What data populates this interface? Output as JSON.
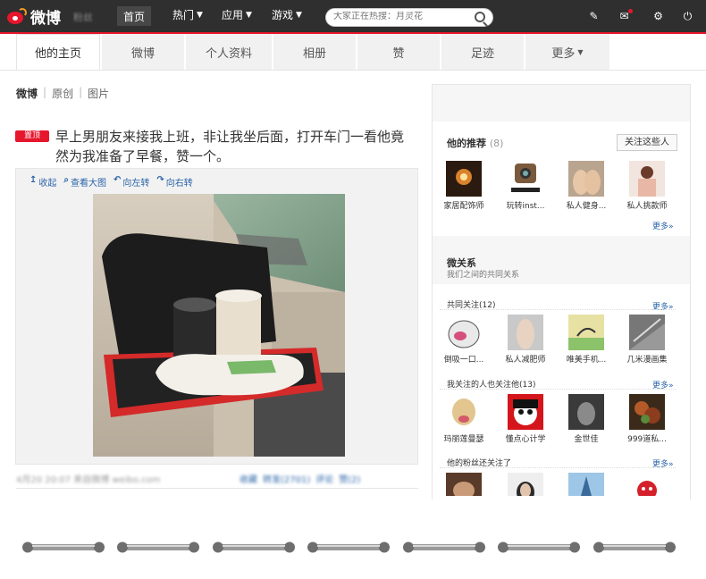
{
  "topbar": {
    "logo_text": "微博",
    "blur_left": "粉丝",
    "nav_home": "首页",
    "nav_hot": "热门",
    "nav_apps": "应用",
    "nav_games": "游戏",
    "search_placeholder": "大家正在热搜：月灵花"
  },
  "tabs": [
    {
      "label": "他的主页"
    },
    {
      "label": "微博"
    },
    {
      "label": "个人资料"
    },
    {
      "label": "相册"
    },
    {
      "label": "赞"
    },
    {
      "label": "足迹"
    },
    {
      "label": "更多"
    }
  ],
  "filters": {
    "a": "微博",
    "b": "原创",
    "c": "图片"
  },
  "post": {
    "badge": "置顶",
    "text": "早上男朋友来接我上班，非让我坐后面，打开车门一看他竟然为我准备了早餐，赞一个。",
    "tools": [
      "收起",
      "查看大图",
      "向左转",
      "向右转"
    ],
    "meta": "4月20 20:07  来自微博 weibo.com",
    "actions": [
      "收藏",
      "转发(2701)",
      "评论",
      "赞(2)"
    ]
  },
  "recommend": {
    "title": "他的推荐",
    "count": "(8)",
    "follow_label": "关注这些人",
    "users": [
      {
        "name": "家居配饰师",
        "icon": "candle-avatar"
      },
      {
        "name": "玩转inst...",
        "icon": "instagram-avatar"
      },
      {
        "name": "私人健身...",
        "icon": "fitness-avatar"
      },
      {
        "name": "私人挑款师",
        "icon": "fashion-avatar"
      }
    ],
    "more": "更多»"
  },
  "relations": {
    "title": "微关系",
    "subtitle": "我们之间的共同关系",
    "common_title": "共同关注(12)",
    "common_users": [
      {
        "name": "倒吸一口...",
        "icon": "cartoon-avatar"
      },
      {
        "name": "私人减肥师",
        "icon": "body-avatar"
      },
      {
        "name": "唯美手机...",
        "icon": "bird-avatar"
      },
      {
        "name": "几米漫画集",
        "icon": "comic-avatar"
      }
    ],
    "mutual_title": "我关注的人也关注他(13)",
    "mutual_users": [
      {
        "name": "玛丽莲曼瑟",
        "icon": "dog-avatar"
      },
      {
        "name": "懂点心计学",
        "icon": "face-avatar"
      },
      {
        "name": "金世佳",
        "icon": "man-avatar"
      },
      {
        "name": "999道私...",
        "icon": "food-avatar"
      }
    ],
    "fans_title": "他的粉丝还关注了",
    "more": "更多»"
  },
  "colors": {
    "brand": "#e6162d",
    "link": "#2a64a8",
    "topbar": "#2f2f2f"
  }
}
